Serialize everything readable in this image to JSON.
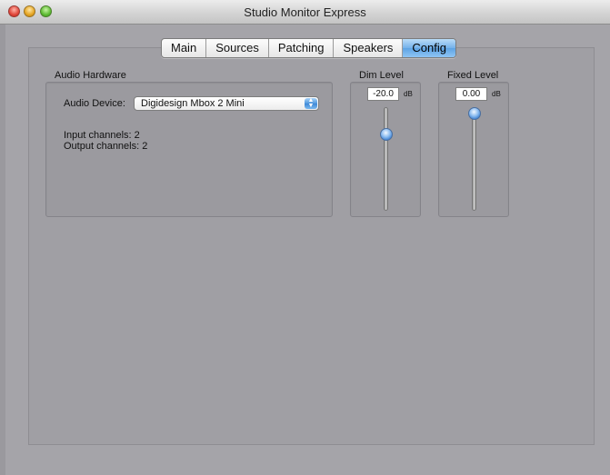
{
  "window": {
    "title": "Studio Monitor Express"
  },
  "tabs": [
    {
      "label": "Main",
      "active": false
    },
    {
      "label": "Sources",
      "active": false
    },
    {
      "label": "Patching",
      "active": false
    },
    {
      "label": "Speakers",
      "active": false
    },
    {
      "label": "Config",
      "active": true
    }
  ],
  "audio_hardware": {
    "heading": "Audio Hardware",
    "device_label": "Audio Device:",
    "device_value": "Digidesign Mbox 2 Mini",
    "input_channels": "Input channels: 2",
    "output_channels": "Output channels: 2"
  },
  "dim_level": {
    "heading": "Dim Level",
    "value": "-20.0",
    "unit": "dB",
    "slider_fraction": 0.77
  },
  "fixed_level": {
    "heading": "Fixed Level",
    "value": "0.00",
    "unit": "dB",
    "slider_fraction": 1.0
  },
  "colors": {
    "accent": "#5da3e4"
  }
}
